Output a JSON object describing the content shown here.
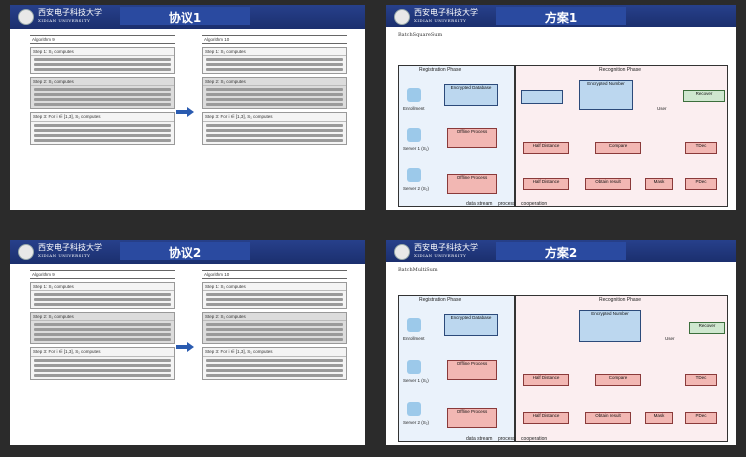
{
  "slides": [
    {
      "title": "协议1",
      "left_algo": "Algorithm 9",
      "right_algo": "Algorithm 10",
      "steps_left": [
        "Step 1: S₁ computes",
        "Step 2: S₁ computes",
        "Step 3: For i ∈ [1,3], S₁ computes"
      ],
      "steps_right": [
        "Step 1: S₁ computes",
        "Step 2: S₁ computes",
        "Step 3: For i ∈ [1,3], S₁ computes"
      ]
    },
    {
      "title": "方案1",
      "subtitle": "BatchSquareSum",
      "registration": "Registration Phase",
      "recognition": "Recognition Phase",
      "user": "User",
      "enroll": "Enrollment",
      "server1": "Server 1 (S₁)",
      "server2": "Server 2 (S₂)",
      "db": "Encrypted Database",
      "enc_number": "Encrypted Number",
      "offline": "Offline Process",
      "halfdist": "Half Distance",
      "compare": "Compare",
      "obtain": "Obtain result",
      "mask": "Mask",
      "tdec": "TDec",
      "pdec": "PDec",
      "recover": "Recover",
      "legend": [
        "data stream",
        "process",
        "cooperation"
      ]
    },
    {
      "title": "协议2",
      "left_algo": "Algorithm 9",
      "right_algo": "Algorithm 10",
      "steps_left": [
        "Step 1: S₁ computes",
        "Step 2: S₁ computes",
        "Step 3: For i ∈ [1,3], S₁ computes"
      ],
      "steps_right": [
        "Step 1: S₁ computes",
        "Step 2: S₁ computes",
        "Step 3: For i ∈ [1,3], S₁ computes"
      ]
    },
    {
      "title": "方案2",
      "subtitle": "BatchMultiSum",
      "registration": "Registration Phase",
      "recognition": "Recognition Phase",
      "user": "User",
      "enroll": "Enrollment",
      "server1": "Server 1 (S₁)",
      "server2": "Server 2 (S₂)",
      "db": "Encrypted Database",
      "enc_number": "Encrypted Number",
      "offline": "Offline Process",
      "halfdist": "Half Distance",
      "compare": "Compare",
      "obtain": "Obtain result",
      "mask": "Mask",
      "tdec": "TDec",
      "pdec": "PDec",
      "recover": "Recover",
      "legend": [
        "data stream",
        "process",
        "cooperation"
      ]
    }
  ],
  "colors": {
    "header": "#27408b",
    "background": "#2b2b2b",
    "registration": "#eaf2fb",
    "recognition": "#fbeef0"
  }
}
